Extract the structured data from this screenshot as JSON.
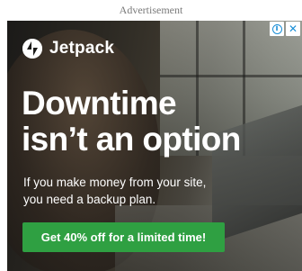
{
  "ad_label": "Advertisement",
  "brand": {
    "name": "Jetpack",
    "color": "#ffffff"
  },
  "headline": {
    "line1": "Downtime",
    "line2": "isn’t an option"
  },
  "subtext": {
    "line1": "If you make money from your site,",
    "line2": "you need a backup plan."
  },
  "cta": {
    "label": "Get 40% off for a limited time!",
    "color": "#2fa042"
  },
  "adchoices": {
    "info_icon": "info-icon",
    "close_icon": "close-icon",
    "close_glyph": "✕",
    "info_glyph": "i"
  }
}
